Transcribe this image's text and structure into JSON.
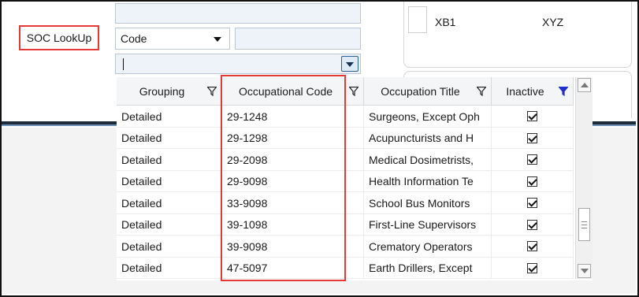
{
  "soc_lookup": {
    "label": "SOC LookUp"
  },
  "search": {
    "field": "Code",
    "value": ""
  },
  "right_panel": {
    "item1": "XB1",
    "item2": "XYZ"
  },
  "grid": {
    "columns": [
      "Grouping",
      "Occupational Code",
      "Occupation Title",
      "Inactive"
    ],
    "rows": [
      {
        "grouping": "Detailed",
        "code": "29-1248",
        "title": "Surgeons, Except Oph",
        "inactive": true
      },
      {
        "grouping": "Detailed",
        "code": "29-1298",
        "title": "Acupuncturists and H",
        "inactive": true
      },
      {
        "grouping": "Detailed",
        "code": "29-2098",
        "title": "Medical Dosimetrists,",
        "inactive": true
      },
      {
        "grouping": "Detailed",
        "code": "29-9098",
        "title": "Health Information Te",
        "inactive": true
      },
      {
        "grouping": "Detailed",
        "code": "33-9098",
        "title": "School Bus Monitors",
        "inactive": true
      },
      {
        "grouping": "Detailed",
        "code": "39-1098",
        "title": "First-Line Supervisors",
        "inactive": true
      },
      {
        "grouping": "Detailed",
        "code": "39-9098",
        "title": "Crematory Operators",
        "inactive": true
      },
      {
        "grouping": "Detailed",
        "code": "47-5097",
        "title": "Earth Drillers, Except",
        "inactive": true
      }
    ]
  },
  "colors": {
    "highlight": "#e53935",
    "active_filter": "#1f2fd1",
    "divider": "#1d2a3a"
  }
}
